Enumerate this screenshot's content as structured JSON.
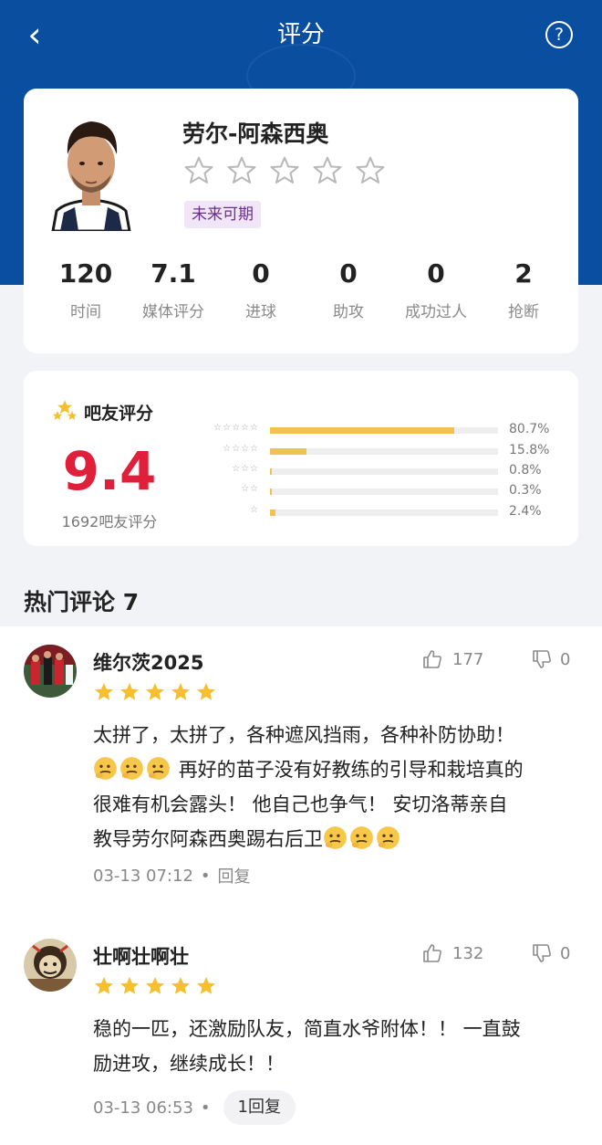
{
  "nav": {
    "title": "评分",
    "back_symbol": "‹",
    "help_symbol": "?"
  },
  "player": {
    "name": "劳尔-阿森西奥",
    "tag": "未来可期",
    "stats": [
      {
        "value": "120",
        "label": "时间"
      },
      {
        "value": "7.1",
        "label": "媒体评分"
      },
      {
        "value": "0",
        "label": "进球"
      },
      {
        "value": "0",
        "label": "助攻"
      },
      {
        "value": "0",
        "label": "成功过人"
      },
      {
        "value": "2",
        "label": "抢断"
      }
    ]
  },
  "fan_rating": {
    "title": "吧友评分",
    "score": "9.4",
    "count_label": "1692吧友评分",
    "distribution": [
      {
        "stars": "☆☆☆☆☆",
        "pct_label": "80.7%",
        "pct": 80.7
      },
      {
        "stars": "☆☆☆☆",
        "pct_label": "15.8%",
        "pct": 15.8
      },
      {
        "stars": "☆☆☆",
        "pct_label": "0.8%",
        "pct": 0.8
      },
      {
        "stars": "☆☆",
        "pct_label": "0.3%",
        "pct": 0.3
      },
      {
        "stars": "☆",
        "pct_label": "2.4%",
        "pct": 2.4
      }
    ]
  },
  "comments_section": {
    "title": "热门评论 7"
  },
  "comments": [
    {
      "user": "维尔茨2025",
      "likes": "177",
      "dislikes": "0",
      "text_line1": "太拼了，太拼了，各种遮风挡雨，各种补防协助！",
      "text_line2": "再好的苗子没有好教练的引导和栽培真的",
      "text_line3": "很难有机会露头！ 他自己也争气！ 安切洛蒂亲自",
      "text_line4": "教导劳尔阿森西奥踢右后卫",
      "time": "03-13 07:12",
      "reply_label": "回复"
    },
    {
      "user": "壮啊壮啊壮",
      "likes": "132",
      "dislikes": "0",
      "text_line1": "稳的一匹，还激励队友，简直水爷附体！！ 一直鼓",
      "text_line2": "励进攻，继续成长！！",
      "time": "03-13 06:53",
      "reply_label": "1回复"
    }
  ],
  "colors": {
    "header_blue": "#0a4ea0",
    "score_red": "#e0203a",
    "star_gold": "#f5bf2e",
    "bar_gold": "#f2c14f"
  }
}
